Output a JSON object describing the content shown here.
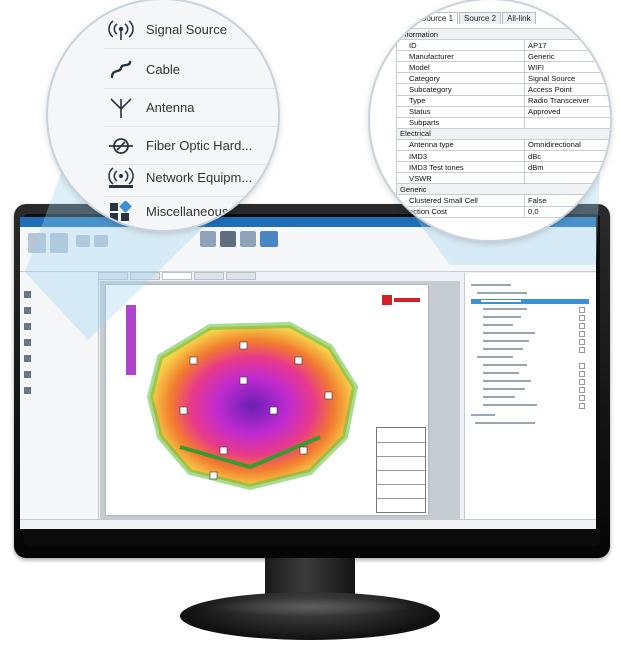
{
  "library": {
    "items": [
      {
        "label": "Signal Source",
        "icon": "signal-source-icon"
      },
      {
        "label": "Cable",
        "icon": "cable-icon"
      },
      {
        "label": "Antenna",
        "icon": "antenna-icon"
      },
      {
        "label": "Fiber Optic Hard...",
        "icon": "fiber-optic-icon"
      },
      {
        "label": "Network Equipm...",
        "icon": "network-equipment-icon"
      },
      {
        "label": "Miscellaneous",
        "icon": "miscellaneous-icon"
      }
    ],
    "chevron": "»"
  },
  "properties": {
    "tabs": [
      "Source 1",
      "Source 2",
      "All-link"
    ],
    "sections": {
      "information": "Information",
      "electrical": "Electrical",
      "generic": "Generic"
    },
    "rows": {
      "id": {
        "key": "ID",
        "value": "AP17"
      },
      "manufacturer": {
        "key": "Manufacturer",
        "value": "Generic"
      },
      "model": {
        "key": "Model",
        "value": "WIFI"
      },
      "category": {
        "key": "Category",
        "value": "Signal Source"
      },
      "subcategory": {
        "key": "Subcategory",
        "value": "Access Point"
      },
      "type": {
        "key": "Type",
        "value": "Radio Transceiver"
      },
      "status": {
        "key": "Status",
        "value": "Approved"
      },
      "subparts": {
        "key": "Subparts",
        "value": ""
      },
      "antenna_type": {
        "key": "Antenna type",
        "value": "Omnidirectional"
      },
      "imd3": {
        "key": "IMD3",
        "value": "dBc"
      },
      "imd3_test_tones": {
        "key": "IMD3 Test tones",
        "value": "dBm"
      },
      "vswr": {
        "key": "VSWR",
        "value": ""
      },
      "clustered_small_cell": {
        "key": "Clustered Small Cell",
        "value": "False"
      },
      "construction_cost": {
        "key": "nction Cost",
        "value": "0,0"
      }
    }
  },
  "colors": {
    "titlebar": "#1e6fb8",
    "selection": "#3b8fd6",
    "brand_red": "#d42027"
  }
}
